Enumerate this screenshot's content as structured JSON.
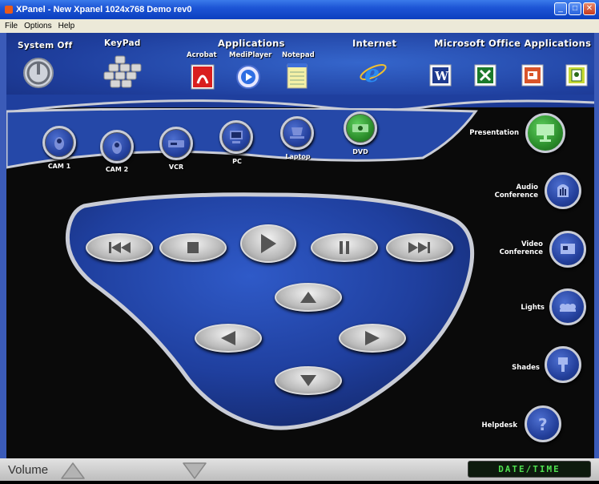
{
  "window": {
    "title": "XPanel - New Xpanel 1024x768 Demo rev0"
  },
  "menu": [
    "File",
    "Options",
    "Help"
  ],
  "top": {
    "system_off": "System Off",
    "keypad": "KeyPad",
    "applications": "Applications",
    "acrobat": "Acrobat",
    "mediplayer": "MediPlayer",
    "notepad": "Notepad",
    "internet": "Internet",
    "office": "Microsoft Office Applications"
  },
  "sources": [
    "CAM 1",
    "CAM 2",
    "VCR",
    "PC",
    "Laptop",
    "DVD"
  ],
  "side": {
    "presentation": "Presentation",
    "audio1": "Audio",
    "audio2": "Conference",
    "video1": "Video",
    "video2": "Conference",
    "lights": "Lights",
    "shades": "Shades",
    "helpdesk": "Helpdesk"
  },
  "bottom": {
    "volume": "Volume",
    "datetime": "DATE/TIME"
  },
  "colors": {
    "brand_blue": "#1f3f9e",
    "frame_blue": "#3b5bb8",
    "active_green": "#2a8c2a",
    "datetime_green": "#4fe04f"
  }
}
